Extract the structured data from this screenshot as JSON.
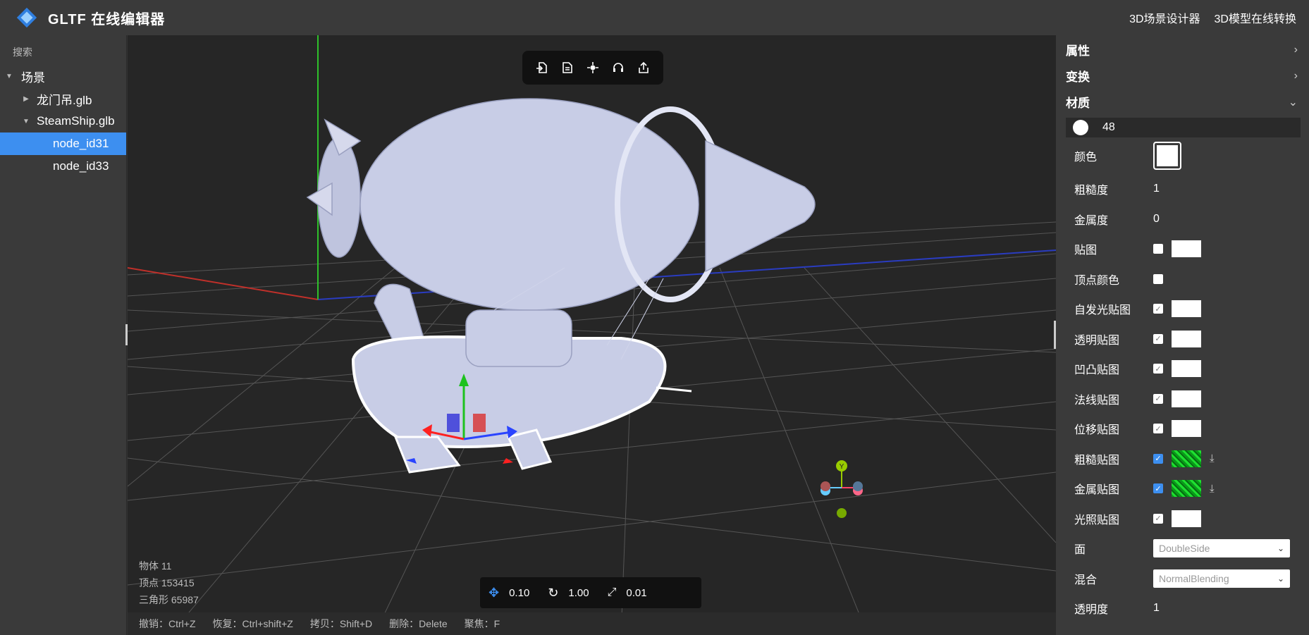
{
  "header": {
    "title": "GLTF 在线编辑器",
    "links": [
      "3D场景设计器",
      "3D模型在线转换"
    ]
  },
  "left_panel": {
    "search_label": "搜索",
    "tree": [
      {
        "label": "场景",
        "level": 0,
        "expanded": true
      },
      {
        "label": "龙门吊.glb",
        "level": 1,
        "expanded": false
      },
      {
        "label": "SteamShip.glb",
        "level": 1,
        "expanded": true
      },
      {
        "label": "node_id31",
        "level": 2,
        "selected": true
      },
      {
        "label": "node_id33",
        "level": 2
      }
    ]
  },
  "viewport": {
    "toolbar_icons": [
      "import-icon",
      "replace-icon",
      "center-icon",
      "headset-icon",
      "export-icon"
    ],
    "stats": {
      "objects": "物体 11",
      "vertices": "顶点 153415",
      "triangles": "三角形 65987"
    },
    "controls": {
      "translate_value": "0.10",
      "rotate_value": "1.00",
      "scale_value": "0.01"
    },
    "shortcuts": [
      "撤销：Ctrl+Z",
      "恢复：Ctrl+shift+Z",
      "拷贝：Shift+D",
      "删除：Delete",
      "聚焦：F"
    ],
    "gizmo_label": "Y"
  },
  "right_panel": {
    "sections": {
      "attributes": "属性",
      "transform": "变换",
      "material": "材质"
    },
    "material_name": "48",
    "props": {
      "color": "颜色",
      "roughness": "粗糙度",
      "roughness_value": "1",
      "metalness": "金属度",
      "metalness_value": "0",
      "face": "面",
      "face_value": "DoubleSide",
      "blending": "混合",
      "blending_value": "NormalBlending",
      "opacity": "透明度",
      "opacity_value": "1"
    },
    "maps": [
      {
        "label": "贴图",
        "checked": false,
        "swatch": "white",
        "download": false
      },
      {
        "label": "顶点颜色",
        "checked": false,
        "swatch": "none",
        "download": false
      },
      {
        "label": "自发光贴图",
        "checked": false,
        "swatch": "white",
        "download": false
      },
      {
        "label": "透明贴图",
        "checked": false,
        "swatch": "white",
        "download": false
      },
      {
        "label": "凹凸贴图",
        "checked": false,
        "swatch": "white",
        "download": false
      },
      {
        "label": "法线贴图",
        "checked": false,
        "swatch": "white",
        "download": false
      },
      {
        "label": "位移贴图",
        "checked": false,
        "swatch": "white",
        "download": false
      },
      {
        "label": "粗糙贴图",
        "checked": true,
        "swatch": "green",
        "download": true
      },
      {
        "label": "金属贴图",
        "checked": true,
        "swatch": "green",
        "download": true
      },
      {
        "label": "光照贴图",
        "checked": false,
        "swatch": "white",
        "download": false
      }
    ]
  }
}
